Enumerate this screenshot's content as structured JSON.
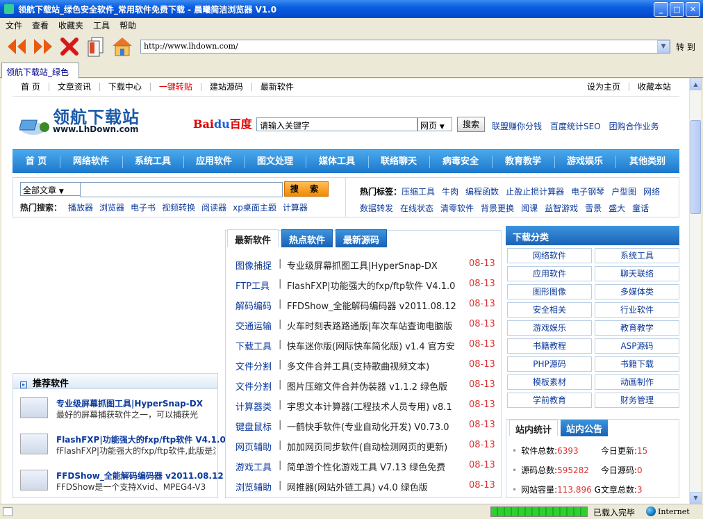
{
  "window": {
    "title": "领航下载站_绿色安全软件_常用软件免费下载 - 晨曦简洁浏览器 V1.0"
  },
  "menu": [
    "文件",
    "查看",
    "收藏夹",
    "工具",
    "帮助"
  ],
  "address": {
    "url": "http://www.lhdown.com/",
    "go_label": "转 到"
  },
  "tab": {
    "label": "领航下载站_绿色"
  },
  "site": {
    "topnav_left": [
      "首 页",
      "文章资讯",
      "下载中心",
      "一键转贴",
      "建站源码",
      "最新软件"
    ],
    "topnav_right": [
      "设为主页",
      "收藏本站"
    ],
    "logo_cn": "领航下载站",
    "logo_en": "www.LhDown.com",
    "baidu_a": "Bai",
    "baidu_b": "du",
    "baidu_c": "百度",
    "search_value": "请输入关键字",
    "search_select": "网页",
    "search_button": "搜索",
    "search_links": [
      "联盟赚你分钱",
      "百度统计SEO",
      "团购合作业务"
    ],
    "mainnav": [
      "首 页",
      "网络软件",
      "系统工具",
      "应用软件",
      "图文处理",
      "媒体工具",
      "联络聊天",
      "病毒安全",
      "教育教学",
      "游戏娱乐",
      "其他类别"
    ],
    "filter": {
      "select": "全部文章",
      "button": "搜 索",
      "hot_label": "热门搜索：",
      "hot": [
        "播放器",
        "浏览器",
        "电子书",
        "视频转换",
        "阅读器",
        "xp桌面主题",
        "计算器"
      ],
      "tags_label": "热门标签：",
      "tags_row1": [
        "压缩工具",
        "牛肉",
        "编程函数",
        "止盈止损计算器",
        "电子钢琴",
        "户型图",
        "网络"
      ],
      "tags_row2": [
        "数据转发",
        "在线状态",
        "清零软件",
        "背景更换",
        "闻课",
        "益智游戏",
        "雪景",
        "盛大",
        "童话"
      ]
    },
    "recommend": {
      "title": "推荐软件",
      "items": [
        {
          "title": "专业级屏幕抓图工具|HyperSnap-DX",
          "desc": "最好的屏幕捕获软件之一，可以捕获光"
        },
        {
          "title": "FlashFXP|功能强大的fxp/ftp软件  V4.1.0",
          "desc": "fFlashFXP|功能强大的fxp/ftp软件,此版是注"
        },
        {
          "title": "FFDShow_全能解码编码器  v2011.08.12",
          "desc": "FFDShow是一个支持Xvid、MPEG4-V3"
        }
      ]
    },
    "software": {
      "tabs": [
        "最新软件",
        "热点软件",
        "最新源码"
      ],
      "rows": [
        {
          "cat": "图像捕捉",
          "name": "专业级屏幕抓图工具|HyperSnap-DX",
          "date": "08-13"
        },
        {
          "cat": "FTP工具",
          "name": "FlashFXP|功能强大的fxp/ftp软件  V4.1.0",
          "date": "08-13"
        },
        {
          "cat": "解码编码",
          "name": "FFDShow_全能解码编码器  v2011.08.12",
          "date": "08-13"
        },
        {
          "cat": "交通运输",
          "name": "火车时刻表路路通版|车次车站查询电脑版",
          "date": "08-13"
        },
        {
          "cat": "下载工具",
          "name": "快车迷你版(网际快车简化版) v1.4 官方安",
          "date": "08-13"
        },
        {
          "cat": "文件分割",
          "name": "多文件合并工具(支持歌曲视频文本)",
          "date": "08-13"
        },
        {
          "cat": "文件分割",
          "name": "图片压缩文件合并伪装器  v1.1.2 绿色版",
          "date": "08-13"
        },
        {
          "cat": "计算器类",
          "name": "宇思文本计算器(工程技术人员专用) v8.1",
          "date": "08-13"
        },
        {
          "cat": "键盘鼠标",
          "name": "一鹤快手软件(专业自动化开发) V0.73.0",
          "date": "08-13"
        },
        {
          "cat": "网页辅助",
          "name": "加加网页同步软件(自动检测网页的更新)",
          "date": "08-13"
        },
        {
          "cat": "游戏工具",
          "name": "简单游个性化游戏工具  V7.13 绿色免费",
          "date": "08-13"
        },
        {
          "cat": "浏览辅助",
          "name": "网推器(网站外链工具) v4.0 绿色版",
          "date": "08-13"
        }
      ]
    },
    "categories": {
      "title": "下载分类",
      "items": [
        "网络软件",
        "系统工具",
        "应用软件",
        "聊天联络",
        "图形图像",
        "多媒体类",
        "安全相关",
        "行业软件",
        "游戏娱乐",
        "教育教学",
        "书籍教程",
        "ASP源码",
        "PHP源码",
        "书籍下载",
        "模板素材",
        "动画制作",
        "学前教育",
        "财务管理"
      ]
    },
    "stats": {
      "tabs": [
        "站内统计",
        "站内公告"
      ],
      "soft_total_label": "软件总数:",
      "soft_total": "6393",
      "today_update_label": "今日更新:",
      "today_update": "15",
      "src_total_label": "源码总数:",
      "src_total": "595282",
      "today_src_label": "今日源码:",
      "today_src": "0",
      "capacity_label": "网站容量:",
      "capacity": "113.896",
      "capacity_unit": "G",
      "article_label": "文章总数:",
      "article": "3"
    }
  },
  "status": {
    "text": "已载入完毕",
    "zone": "Internet",
    "progress": 1.0
  }
}
